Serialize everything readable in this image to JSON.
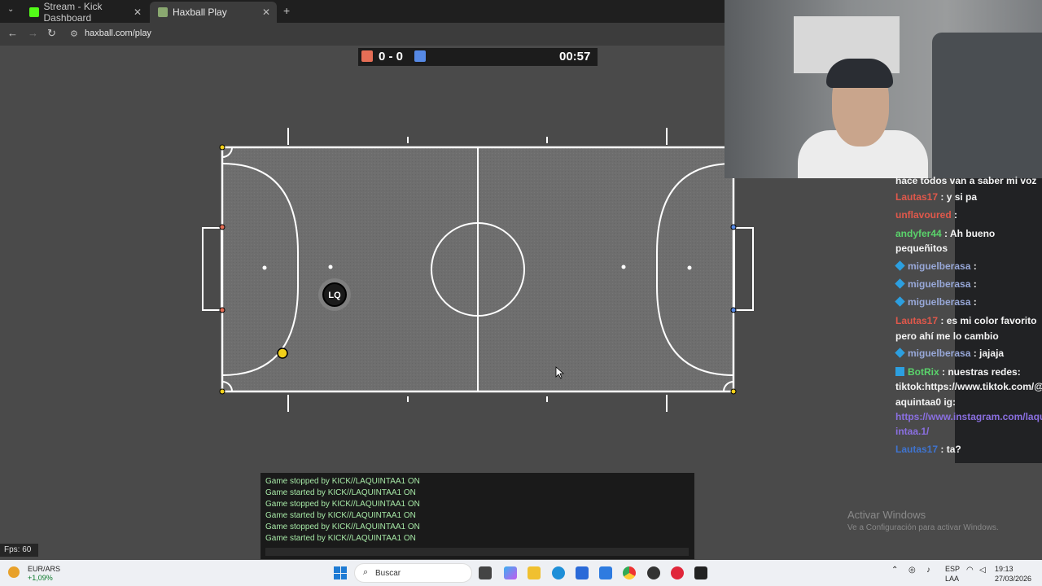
{
  "browser": {
    "tabs": [
      {
        "label": "Stream - Kick Dashboard",
        "favicon_color": "#53fc18"
      },
      {
        "label": "Haxball Play",
        "favicon_color": "#8aa870"
      }
    ],
    "new_tab": "+",
    "url": "haxball.com/play"
  },
  "game": {
    "score": "0 - 0",
    "timer": "00:57",
    "fps": "Fps: 60",
    "player_avatar": "LQ",
    "chat_log": [
      "Game stopped by KICK//LAQUINTAA1 ON",
      "Game started by KICK//LAQUINTAA1 ON",
      "Game stopped by KICK//LAQUINTAA1 ON",
      "Game started by KICK//LAQUINTAA1 ON",
      "Game stopped by KICK//LAQUINTAA1 ON",
      "Game started by KICK//LAQUINTAA1 ON"
    ],
    "colors": {
      "red_team": "#e56e56",
      "blue_team": "#5689e5",
      "ball": "#f2d01a"
    }
  },
  "stream_chat": {
    "rows": [
      {
        "user": "",
        "text": "hace todos van a saber mi voz"
      },
      {
        "user": "Lautas17",
        "text": ": y si pa"
      },
      {
        "user": "unflavoured",
        "text": ":"
      },
      {
        "user": "andyfer44",
        "text": ": Ah bueno"
      },
      {
        "user": "",
        "text": "pequeñitos"
      },
      {
        "user": "miguelberasa",
        "text": ":"
      },
      {
        "user": "miguelberasa",
        "text": ":"
      },
      {
        "user": "miguelberasa",
        "text": ":"
      },
      {
        "user": "Lautas17",
        "text": ": es mi color favorito"
      },
      {
        "user": "",
        "text": "pero ahí me lo cambio"
      },
      {
        "user": "miguelberasa",
        "text": ": jajaja"
      },
      {
        "user": "BotRix",
        "text": ": nuestras redes:"
      },
      {
        "user": "",
        "text": "tiktok:https://www.tiktok.com/@l"
      },
      {
        "user": "",
        "text": "aquintaa0 ig:"
      },
      {
        "user": "",
        "text": "https://www.instagram.com/laqu"
      },
      {
        "user": "",
        "text": "intaa.1/"
      },
      {
        "user": "Lautas17",
        "text": ": ta?"
      }
    ]
  },
  "windows": {
    "activate_title": "Activar Windows",
    "activate_sub": "Ve a Configuración para activar Windows.",
    "taskbar": {
      "currency": "EUR/ARS",
      "currency_change": "+1,09%",
      "search_placeholder": "Buscar",
      "lang": "ESP",
      "lang_sub": "LAA",
      "time": "19:13",
      "date": "27/03/2026"
    }
  }
}
